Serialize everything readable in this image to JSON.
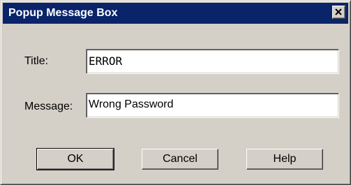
{
  "window": {
    "title": "Popup Message Box",
    "close_icon": "close-icon"
  },
  "form": {
    "title_label": "Title:",
    "title_value": "ERROR",
    "message_label": "Message:",
    "message_value": "Wrong Password"
  },
  "buttons": {
    "ok": "OK",
    "cancel": "Cancel",
    "help": "Help"
  },
  "colors": {
    "titlebar": "#0a246a",
    "dialog_bg": "#d4d0c8"
  }
}
